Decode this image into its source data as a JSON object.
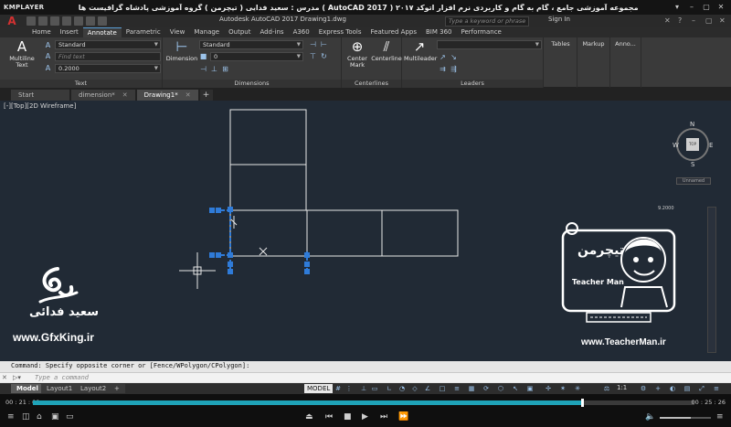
{
  "player": {
    "name": "KMPLAYER",
    "title": "مجموعه آموزشی جامع ، گام به گام و کاربردی نرم افزار اتوکد ۲۰۱۷ ( AutoCAD 2017 ) مدرس : سعید فدایی ( تیچرمن ) گروه آموزشی پادشاه گرافیست ها",
    "time_elapsed": "00 : 21 : 09",
    "time_total": "00 : 25 : 26",
    "progress_fraction": 0.83,
    "volume_fraction": 0.6
  },
  "acad": {
    "logo": "A",
    "doc_title": "Autodesk AutoCAD 2017    Drawing1.dwg",
    "search_placeholder": "Type a keyword or phrase",
    "sign_in": "Sign In"
  },
  "ribbon_tabs": [
    "Home",
    "Insert",
    "Annotate",
    "Parametric",
    "View",
    "Manage",
    "Output",
    "Add-ins",
    "A360",
    "Express Tools",
    "Featured Apps",
    "BIM 360",
    "Performance"
  ],
  "active_ribbon_tab": "Annotate",
  "ribbon": {
    "text_panel": {
      "title": "Text",
      "multiline_label": "Multiline Text",
      "style": "Standard",
      "find_placeholder": "Find text",
      "height": "0.2000"
    },
    "dimensions_panel": {
      "title": "Dimensions",
      "dimension_label": "Dimension",
      "style": "Standard",
      "layer_value": "0"
    },
    "centerlines_panel": {
      "title": "Centerlines",
      "center_mark_label": "Center Mark",
      "centerline_label": "Centerline"
    },
    "leaders_panel": {
      "title": "Leaders",
      "multileader_label": "Multileader"
    },
    "tables_label": "Tables",
    "markup_label": "Markup",
    "annotation_label": "Anno..."
  },
  "doc_tabs": [
    {
      "label": "Start"
    },
    {
      "label": "dimension*"
    },
    {
      "label": "Drawing1*"
    }
  ],
  "viewport_label": "[-][Top][2D Wireframe]",
  "viewcube": {
    "n": "N",
    "s": "S",
    "e": "E",
    "w": "W",
    "face": "TOP",
    "wcs": "Unnamed"
  },
  "scale_marker": "9.2000",
  "watermarks": {
    "gfx_name": "سعید فدائی",
    "gfx_url": "www.GfxKing.ir",
    "teacher_brand": "تیچرمن",
    "teacher_brand_en": "Teacher Man",
    "teacher_url": "www.TeacherMan.ir"
  },
  "command": {
    "history": "Command: Specify opposite corner or [Fence/WPolygon/CPolygon]:",
    "placeholder": "Type a command"
  },
  "layout_tabs": [
    "Model",
    "Layout1",
    "Layout2"
  ],
  "active_layout": "Model",
  "status": {
    "model": "MODEL",
    "scale": "1:1"
  }
}
